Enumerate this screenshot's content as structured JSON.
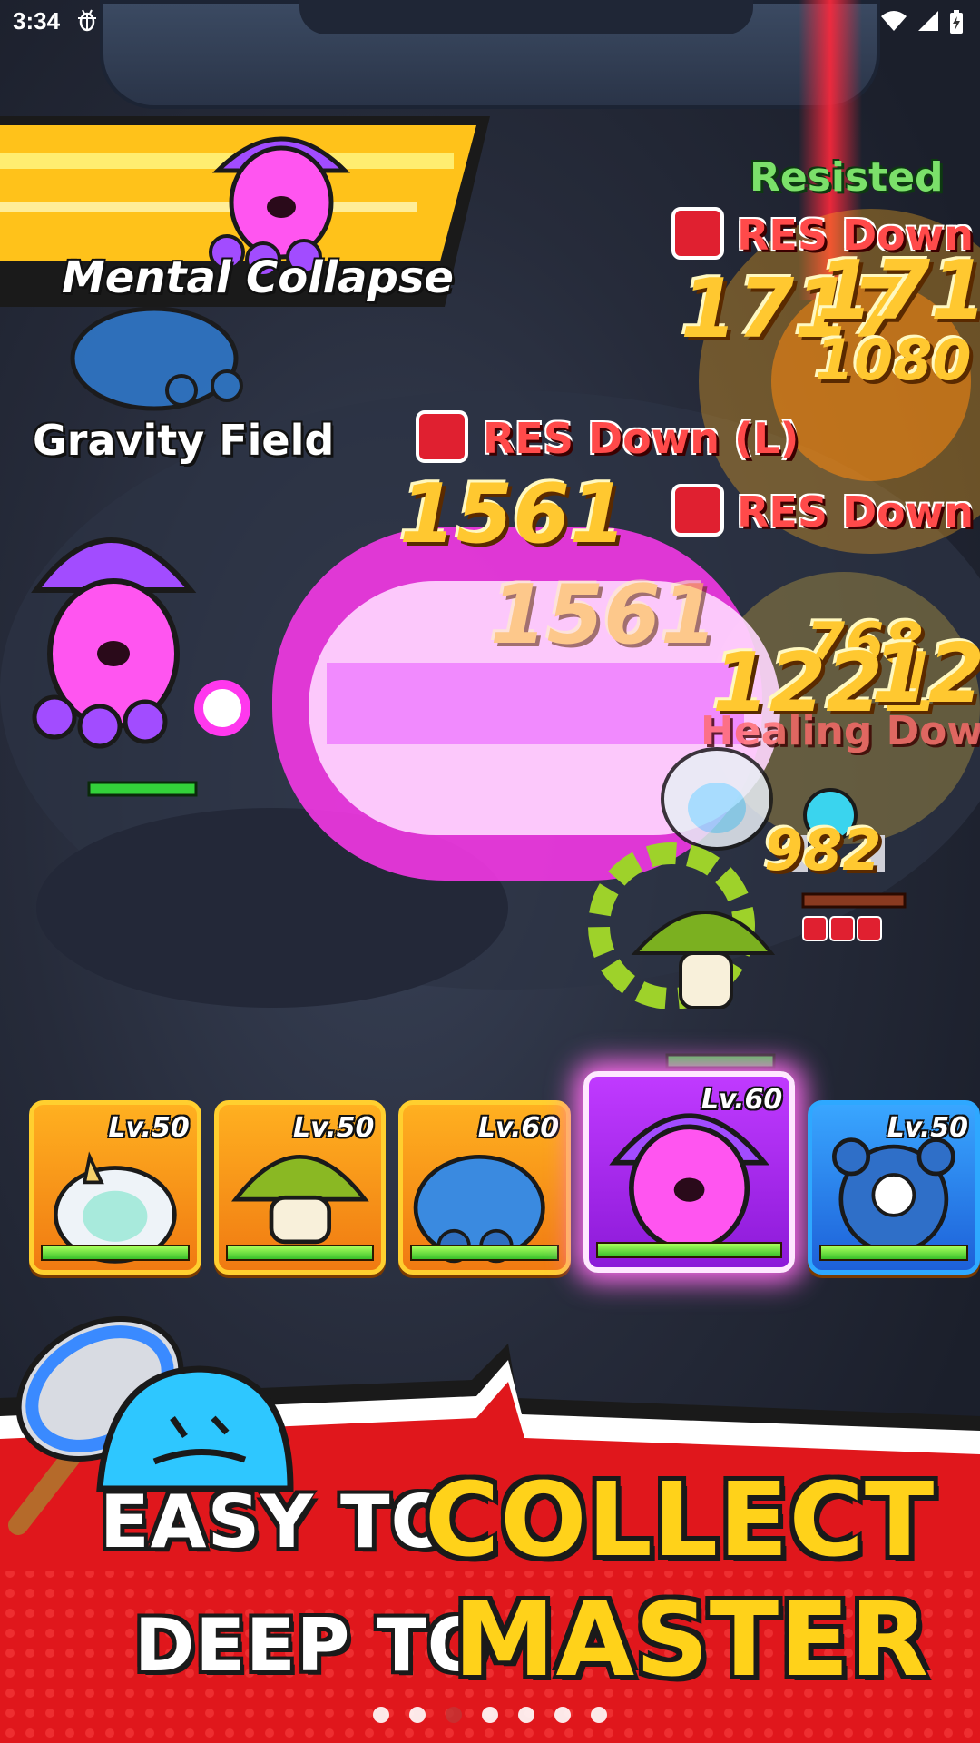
{
  "status_bar": {
    "time": "3:34",
    "icons": [
      "bug-icon",
      "wifi-icon",
      "signal-icon",
      "battery-icon"
    ]
  },
  "battle": {
    "skill_banner": "Mental Collapse",
    "skill_field": "Gravity Field",
    "resisted": "Resisted",
    "debuffs": [
      "RES Down (",
      "RES Down (L)",
      "RES Down (",
      "Healing Dow"
    ],
    "damage_numbers": [
      "1717",
      "1717",
      "1080",
      "1561",
      "1561",
      "1221",
      "122",
      "768",
      "982"
    ]
  },
  "heroes": [
    {
      "level": "Lv.50",
      "name_icon": "yeti-hero-icon",
      "hp": 1.0,
      "theme": "orange"
    },
    {
      "level": "Lv.50",
      "name_icon": "mushroom-hero-icon",
      "hp": 1.0,
      "theme": "orange"
    },
    {
      "level": "Lv.60",
      "name_icon": "blue-dragon-hero-icon",
      "hp": 1.0,
      "theme": "orange"
    },
    {
      "level": "Lv.60",
      "name_icon": "squid-hero-icon",
      "hp": 1.0,
      "theme": "purple"
    },
    {
      "level": "Lv.50",
      "name_icon": "blue-bear-hero-icon",
      "hp": 1.0,
      "theme": "blue"
    }
  ],
  "promo": {
    "line1_white": "EASY TO",
    "line1_yellow": "COLLECT",
    "line2_white": "DEEP TO",
    "line2_yellow": "MASTER"
  },
  "pager": {
    "count": 7,
    "active": 3
  },
  "colors": {
    "debuff": "#ff4a4a",
    "damage": "#ffc830",
    "resisted": "#7be06a",
    "promo_red": "#e0171c",
    "accent_yellow": "#ffd21a"
  }
}
